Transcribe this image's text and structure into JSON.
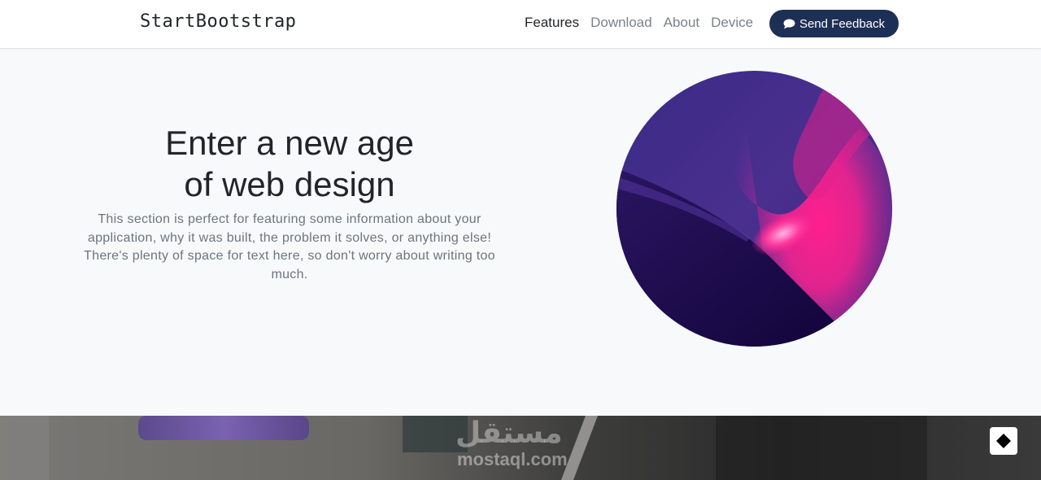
{
  "navbar": {
    "brand": "StartBootstrap",
    "links": [
      {
        "label": "Features",
        "active": true
      },
      {
        "label": "Download",
        "active": false
      },
      {
        "label": "About",
        "active": false
      },
      {
        "label": "Device",
        "active": false
      }
    ],
    "cta_label": "Send Feedback",
    "cta_icon": "chat-bubble-icon"
  },
  "hero": {
    "title_line1": "Enter a new age",
    "title_line2": "of web design",
    "text": "This section is perfect for featuring some information about your application, why it was built, the problem it solves, or anything else! There's plenty of space for text here, so don't worry about writing too much."
  },
  "banner": {
    "watermark_ar": "مستقل",
    "watermark_en": "mostaql.com",
    "corner_icon": "diamond-icon"
  },
  "colors": {
    "navy": "#1e2f55",
    "page_bg": "#f8f9fa",
    "text_dark": "#212529",
    "text_muted": "#6c757d"
  }
}
